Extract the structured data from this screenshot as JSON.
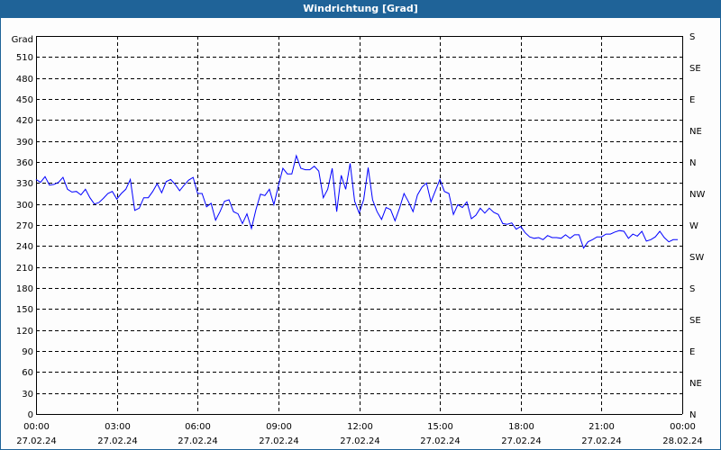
{
  "title": "Windrichtung [Grad]",
  "chart_data": {
    "type": "line",
    "title": "Windrichtung [Grad]",
    "ylabel": "Grad",
    "ylim": [
      0,
      540
    ],
    "y_ticks": [
      0,
      30,
      60,
      90,
      120,
      150,
      180,
      210,
      240,
      270,
      300,
      330,
      360,
      390,
      420,
      450,
      480,
      510
    ],
    "y2_ticks": [
      {
        "value": 0,
        "label": "N"
      },
      {
        "value": 45,
        "label": "NE"
      },
      {
        "value": 90,
        "label": "E"
      },
      {
        "value": 135,
        "label": "SE"
      },
      {
        "value": 180,
        "label": "S"
      },
      {
        "value": 225,
        "label": "SW"
      },
      {
        "value": 270,
        "label": "W"
      },
      {
        "value": 315,
        "label": "NW"
      },
      {
        "value": 360,
        "label": "N"
      },
      {
        "value": 405,
        "label": "NE"
      },
      {
        "value": 450,
        "label": "E"
      },
      {
        "value": 495,
        "label": "SE"
      },
      {
        "value": 540,
        "label": "S"
      }
    ],
    "xlim_hours": [
      0,
      24
    ],
    "x_ticks": [
      {
        "hour": 0,
        "time": "00:00",
        "date": "27.02.24"
      },
      {
        "hour": 3,
        "time": "03:00",
        "date": "27.02.24"
      },
      {
        "hour": 6,
        "time": "06:00",
        "date": "27.02.24"
      },
      {
        "hour": 9,
        "time": "09:00",
        "date": "27.02.24"
      },
      {
        "hour": 12,
        "time": "12:00",
        "date": "27.02.24"
      },
      {
        "hour": 15,
        "time": "15:00",
        "date": "27.02.24"
      },
      {
        "hour": 18,
        "time": "18:00",
        "date": "27.02.24"
      },
      {
        "hour": 21,
        "time": "21:00",
        "date": "27.02.24"
      },
      {
        "hour": 24,
        "time": "00:00",
        "date": "28.02.24"
      }
    ],
    "grid": true,
    "step_minutes": 10,
    "series": [
      {
        "name": "Windrichtung",
        "color": "#0000ff",
        "values": [
          335,
          331,
          339,
          327,
          328,
          331,
          338,
          321,
          317,
          318,
          313,
          321,
          309,
          300,
          302,
          308,
          315,
          318,
          307,
          315,
          321,
          335,
          291,
          294,
          309,
          309,
          318,
          329,
          316,
          332,
          335,
          328,
          319,
          327,
          334,
          338,
          315,
          315,
          296,
          301,
          277,
          289,
          304,
          306,
          289,
          286,
          272,
          286,
          265,
          292,
          314,
          312,
          321,
          299,
          326,
          351,
          343,
          343,
          369,
          351,
          349,
          349,
          354,
          347,
          309,
          321,
          351,
          289,
          341,
          321,
          358,
          304,
          287,
          306,
          352,
          306,
          289,
          278,
          295,
          292,
          276,
          294,
          315,
          303,
          289,
          313,
          324,
          330,
          303,
          319,
          335,
          318,
          315,
          285,
          299,
          295,
          303,
          279,
          284,
          294,
          287,
          294,
          288,
          285,
          272,
          271,
          273,
          264,
          268,
          259,
          253,
          251,
          252,
          249,
          255,
          252,
          252,
          251,
          256,
          251,
          256,
          256,
          237,
          246,
          249,
          253,
          253,
          257,
          257,
          260,
          262,
          261,
          251,
          257,
          254,
          261,
          247,
          249,
          253,
          261,
          252,
          246,
          249,
          249
        ]
      }
    ]
  }
}
